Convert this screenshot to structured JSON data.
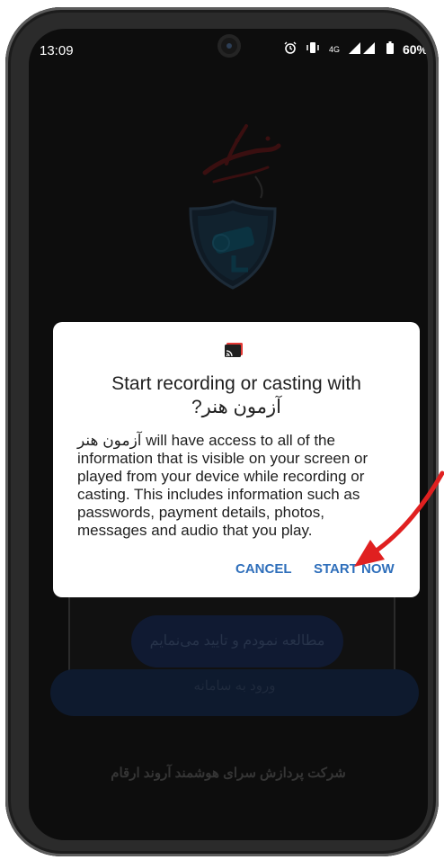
{
  "status_bar": {
    "time": "13:09",
    "alarm_icon": "alarm-icon",
    "vibrate_icon": "vibrate-icon",
    "network": "4G",
    "battery": "60%"
  },
  "background": {
    "app_logo_icon": "app-logo-icon",
    "camera_shield_icon": "camera-shield-icon",
    "agree_button": "مطالعه نمودم و تایید می‌نمایم",
    "login_button": "ورود به سامانه",
    "footer": "شرکت پردازش سرای هوشمند آروند ارقام"
  },
  "dialog": {
    "icon": "cast-icon",
    "title_line1": "Start recording or casting with",
    "title_line2": "آزمون هنر?",
    "app_name": "آزمون هنر",
    "body_rest": " will have access to all of the information that is visible on your screen or played from your device while recording or casting. This includes information such as passwords, payment details, photos, messages and audio that you play.",
    "cancel_label": "CANCEL",
    "start_label": "START NOW"
  },
  "colors": {
    "accent": "#2f6fbb",
    "arrow": "#e02020"
  }
}
